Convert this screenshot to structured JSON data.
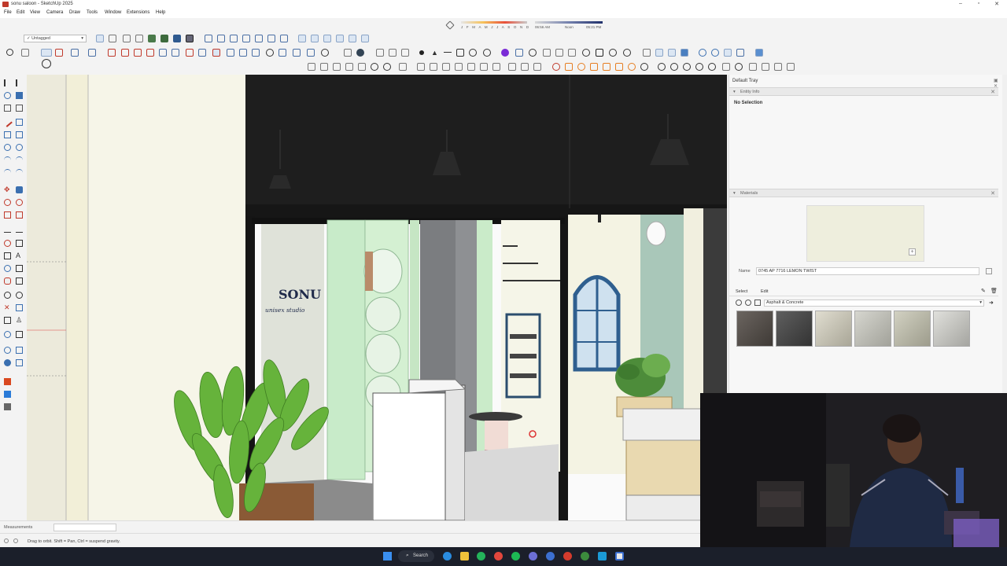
{
  "window": {
    "title": "sonu saloon - SketchUp 2025",
    "controls": [
      "–",
      "▫",
      "✕"
    ]
  },
  "menu": [
    "File",
    "Edit",
    "View",
    "Camera",
    "Draw",
    "Tools",
    "Window",
    "Extensions",
    "Help"
  ],
  "toolbar": {
    "tag_dropdown": "✓ Untagged",
    "shadow_months": "J F M A M J J A S O N D",
    "shadow_time_start": "06:56 AM",
    "shadow_noon": "Noon",
    "shadow_time_end": "05:21 PM"
  },
  "scene": {
    "sign_line1": "SONU",
    "sign_line2": "unisex studio"
  },
  "tray": {
    "title": "Default Tray",
    "entity_info": {
      "header": "Entity Info",
      "selection": "No Selection"
    },
    "materials": {
      "header": "Materials",
      "name_label": "Name",
      "name_value": "0745 AP 7716 LEMON TWIST",
      "tab_select": "Select",
      "tab_edit": "Edit",
      "library": "Asphalt & Concrete",
      "swatch_colors": [
        "#55504c",
        "#4a4a4a",
        "#c6c3b5",
        "#bdbdb5",
        "#b8b7a8",
        "#c7c7c3"
      ],
      "preview_color": "#eeeedd"
    }
  },
  "status": {
    "measurements_label": "Measurements",
    "hint": "Drag to orbit. Shift = Pan, Ctrl = suspend gravity."
  },
  "taskbar": {
    "search_label": "Search"
  }
}
